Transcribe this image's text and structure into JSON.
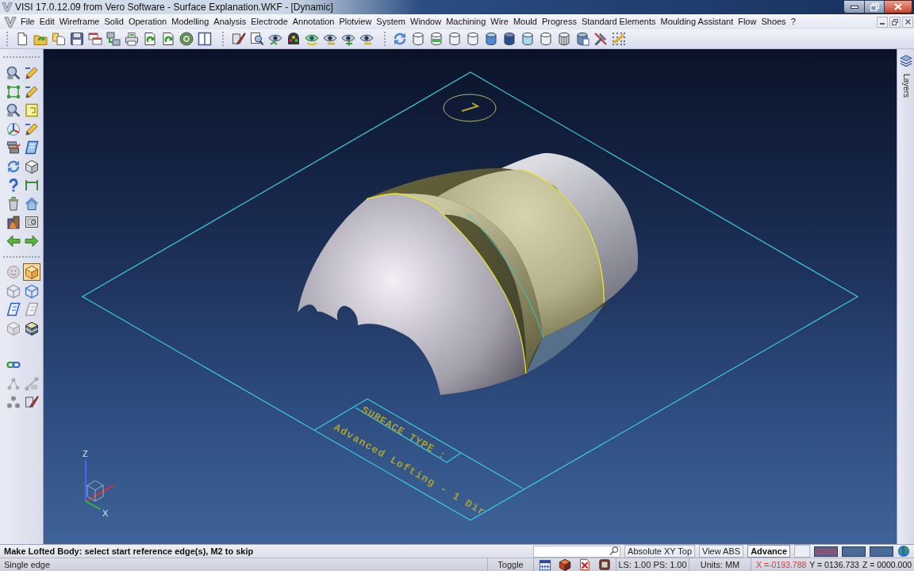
{
  "window": {
    "title": "VISI 17.0.12.09 from Vero Software - Surface Explanation.WKF - [Dynamic]"
  },
  "menu": [
    "File",
    "Edit",
    "Wireframe",
    "Solid",
    "Operation",
    "Modelling",
    "Analysis",
    "Electrode",
    "Annotation",
    "Plotview",
    "System",
    "Window",
    "Machining",
    "Wire",
    "Mould",
    "Progress",
    "Standard Elements",
    "Moulding Assistant",
    "Flow",
    "Shoes",
    "?"
  ],
  "left_toolbar": {
    "display_modes": [
      {
        "selected": false
      },
      {
        "selected": true
      },
      {
        "selected": false
      },
      {
        "selected": false
      },
      {
        "selected": false
      },
      {
        "selected": false
      },
      {
        "selected": false
      },
      {
        "selected": false
      }
    ]
  },
  "viewport": {
    "annotation": {
      "title": "SURFACE TYPE :",
      "text": "Advanced Lofting - 1 Dir"
    },
    "axes": [
      "Z",
      "X"
    ]
  },
  "side_panel": {
    "title": "Layers"
  },
  "status_bar": {
    "prompt": "Make Lofted Body: select start reference edge(s), M2 to skip",
    "view_buttons": [
      {
        "label": "Absolute XY Top",
        "selected": false
      },
      {
        "label": "View ABS",
        "selected": false
      },
      {
        "label": "Advance",
        "selected": true
      }
    ],
    "hint": "Single edge",
    "toggle": "Toggle",
    "scale": "LS: 1.00 PS: 1.00",
    "units": "Units: MM",
    "coordinates": [
      {
        "label": "X =-0193.788",
        "highlighted": true
      },
      {
        "label": "Y = 0136.733",
        "highlighted": false
      },
      {
        "label": "Z = 0000.000",
        "highlighted": false
      }
    ]
  }
}
